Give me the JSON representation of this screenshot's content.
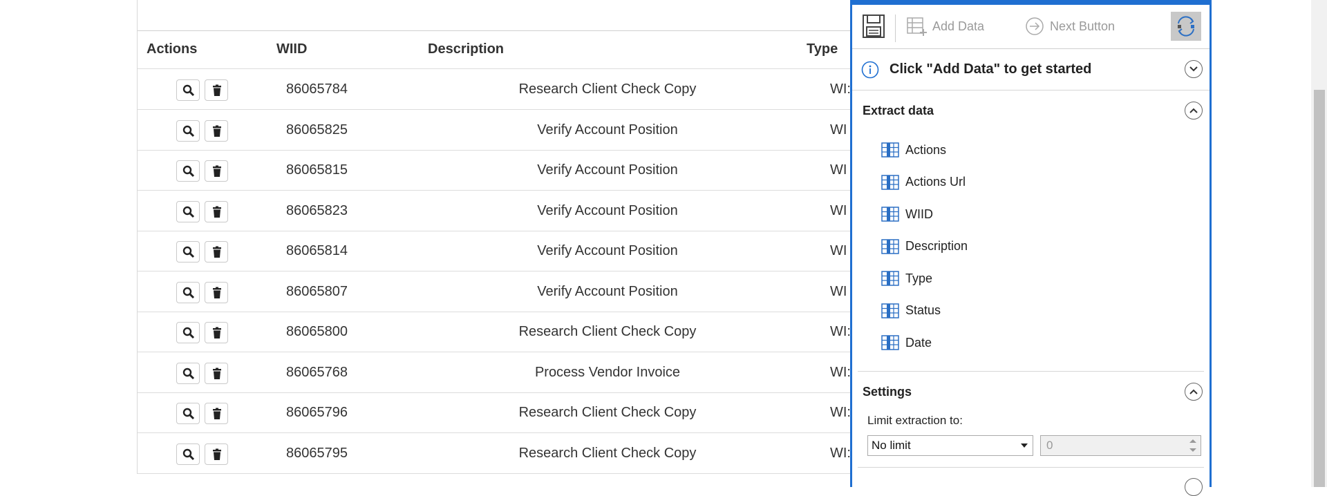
{
  "table": {
    "headers": {
      "actions": "Actions",
      "wiid": "WIID",
      "description": "Description",
      "type": "Type"
    },
    "rows": [
      {
        "wiid": "86065784",
        "description": "Research Client Check Copy",
        "type": "WI:"
      },
      {
        "wiid": "86065825",
        "description": "Verify Account Position",
        "type": "WI"
      },
      {
        "wiid": "86065815",
        "description": "Verify Account Position",
        "type": "WI"
      },
      {
        "wiid": "86065823",
        "description": "Verify Account Position",
        "type": "WI"
      },
      {
        "wiid": "86065814",
        "description": "Verify Account Position",
        "type": "WI"
      },
      {
        "wiid": "86065807",
        "description": "Verify Account Position",
        "type": "WI"
      },
      {
        "wiid": "86065800",
        "description": "Research Client Check Copy",
        "type": "WI:"
      },
      {
        "wiid": "86065768",
        "description": "Process Vendor Invoice",
        "type": "WI:"
      },
      {
        "wiid": "86065796",
        "description": "Research Client Check Copy",
        "type": "WI:"
      },
      {
        "wiid": "86065795",
        "description": "Research Client Check Copy",
        "type": "WI:"
      }
    ]
  },
  "panel": {
    "toolbar": {
      "add_data": "Add Data",
      "next_button": "Next Button"
    },
    "hint": "Click \"Add Data\" to get started",
    "extract": {
      "title": "Extract data",
      "fields": [
        "Actions",
        "Actions Url",
        "WIID",
        "Description",
        "Type",
        "Status",
        "Date"
      ]
    },
    "settings": {
      "title": "Settings",
      "limit_label": "Limit extraction to:",
      "limit_value": "No limit",
      "limit_count": "0"
    }
  },
  "colors": {
    "accent": "#1f6fd1",
    "field_icon": "#2b6fc4"
  }
}
